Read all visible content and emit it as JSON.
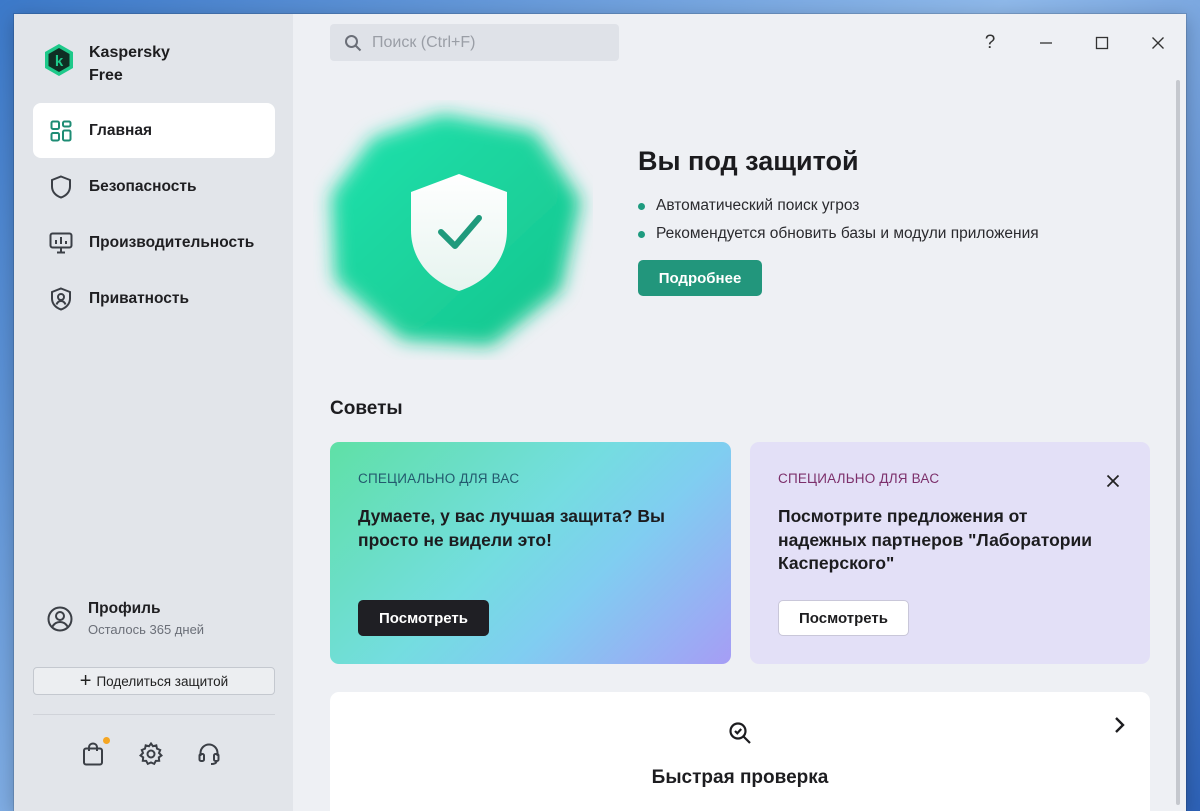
{
  "app": {
    "name_line1": "Kaspersky",
    "name_line2": "Free",
    "accent": "#22967c"
  },
  "sidebar": {
    "items": [
      {
        "label": "Главная",
        "icon": "dashboard-icon",
        "active": true
      },
      {
        "label": "Безопасность",
        "icon": "shield-icon",
        "active": false
      },
      {
        "label": "Производительность",
        "icon": "monitor-gauge-icon",
        "active": false
      },
      {
        "label": "Приватность",
        "icon": "privacy-shield-icon",
        "active": false
      }
    ],
    "profile": {
      "name": "Профиль",
      "subtitle": "Осталось 365 дней"
    },
    "share_label": "Поделиться защитой",
    "bottom_icons": [
      "store-bag-icon",
      "gear-icon",
      "headset-icon"
    ]
  },
  "search": {
    "placeholder": "Поиск (Ctrl+F)",
    "value": ""
  },
  "window_controls": {
    "help": "?",
    "minimize": "—",
    "maximize": "□",
    "close": "✕"
  },
  "hero": {
    "title": "Вы под защитой",
    "bullets": [
      "Автоматический поиск угроз",
      "Рекомендуется обновить базы и модули приложения"
    ],
    "button_label": "Подробнее",
    "status_color": "#1ed69a"
  },
  "tips": {
    "title": "Советы",
    "cards": [
      {
        "kicker": "СПЕЦИАЛЬНО ДЛЯ ВАС",
        "text": "Думаете, у вас лучшая защита? Вы просто не видели это!",
        "button_label": "Посмотреть"
      },
      {
        "kicker": "СПЕЦИАЛЬНО ДЛЯ ВАС",
        "text": "Посмотрите предложения от надежных партнеров \"Лаборатории Касперского\"",
        "button_label": "Посмотреть",
        "closable": true
      }
    ]
  },
  "quick_scan": {
    "label": "Быстрая проверка",
    "icon": "scan-search-icon"
  }
}
